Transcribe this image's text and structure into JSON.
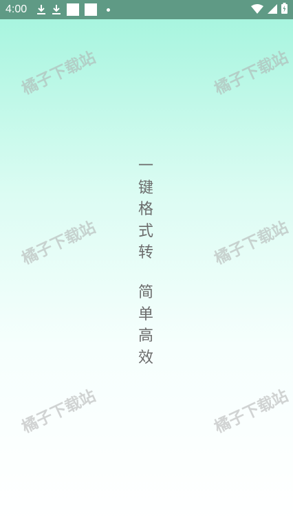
{
  "status_bar": {
    "time": "4:00"
  },
  "slogan": {
    "line1": [
      "一",
      "键",
      "格",
      "式",
      "转"
    ],
    "line2": [
      "简",
      "单",
      "高",
      "效"
    ]
  },
  "watermark": {
    "text": "橘子下载站"
  }
}
